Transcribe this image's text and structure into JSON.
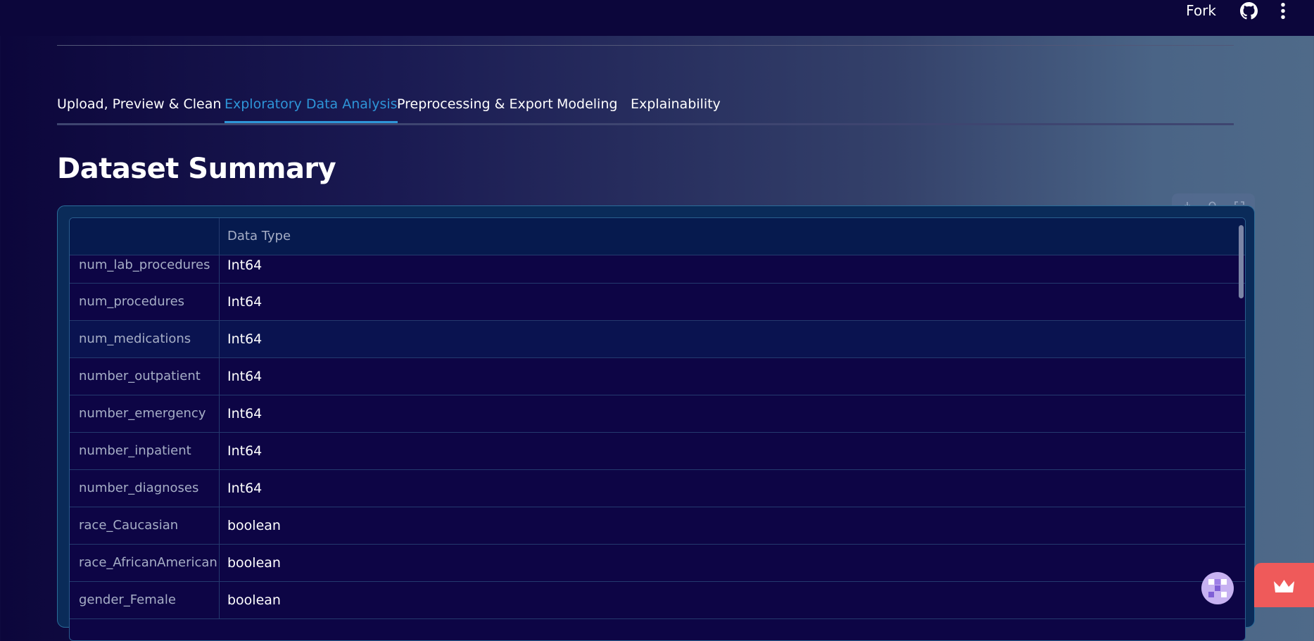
{
  "topbar": {
    "fork_label": "Fork",
    "github_icon": "github-icon",
    "menu_icon": "more-vertical-icon"
  },
  "tabs": [
    {
      "label": "Upload, Preview & Clean",
      "active": false
    },
    {
      "label": "Exploratory Data Analysis",
      "active": true
    },
    {
      "label": "Preprocessing & Export",
      "active": false
    },
    {
      "label": "Modeling",
      "active": false
    },
    {
      "label": "Explainability",
      "active": false
    }
  ],
  "page_title": "Dataset Summary",
  "dataframe": {
    "toolbar_icons": [
      "download-icon",
      "search-icon",
      "fullscreen-icon"
    ],
    "header": {
      "index": "",
      "column": "Data Type"
    },
    "rows": [
      {
        "index": "num_lab_procedures",
        "value": "Int64"
      },
      {
        "index": "num_procedures",
        "value": "Int64"
      },
      {
        "index": "num_medications",
        "value": "Int64"
      },
      {
        "index": "number_outpatient",
        "value": "Int64"
      },
      {
        "index": "number_emergency",
        "value": "Int64"
      },
      {
        "index": "number_inpatient",
        "value": "Int64"
      },
      {
        "index": "number_diagnoses",
        "value": "Int64"
      },
      {
        "index": "race_Caucasian",
        "value": "boolean"
      },
      {
        "index": "race_AfricanAmerican",
        "value": "boolean"
      },
      {
        "index": "gender_Female",
        "value": "boolean"
      }
    ]
  },
  "colors": {
    "accent": "#2e95d8",
    "badge": "#ef5a5a",
    "avatar": "#c7b2f2"
  }
}
